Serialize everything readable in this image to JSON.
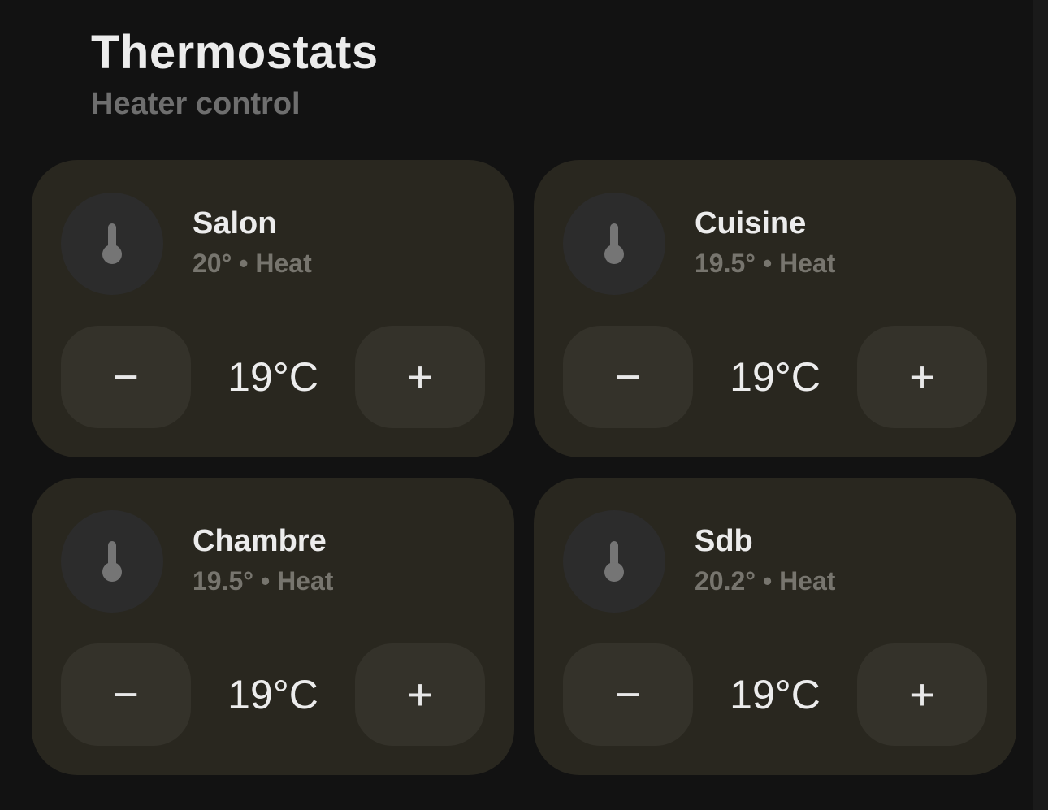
{
  "header": {
    "title": "Thermostats",
    "subtitle": "Heater control"
  },
  "colors": {
    "background": "#121212",
    "card": "#29271f",
    "button": "#34322a",
    "text_primary": "#ececec",
    "text_secondary": "#77756e"
  },
  "thermostats": [
    {
      "name": "Salon",
      "status": "20° • Heat",
      "setpoint": "19°C",
      "icon": "thermometer-icon",
      "decrease_label": "−",
      "increase_label": "+"
    },
    {
      "name": "Cuisine",
      "status": "19.5° • Heat",
      "setpoint": "19°C",
      "icon": "thermometer-icon",
      "decrease_label": "−",
      "increase_label": "+"
    },
    {
      "name": "Chambre",
      "status": "19.5° • Heat",
      "setpoint": "19°C",
      "icon": "thermometer-icon",
      "decrease_label": "−",
      "increase_label": "+"
    },
    {
      "name": "Sdb",
      "status": "20.2° • Heat",
      "setpoint": "19°C",
      "icon": "thermometer-icon",
      "decrease_label": "−",
      "increase_label": "+"
    }
  ]
}
